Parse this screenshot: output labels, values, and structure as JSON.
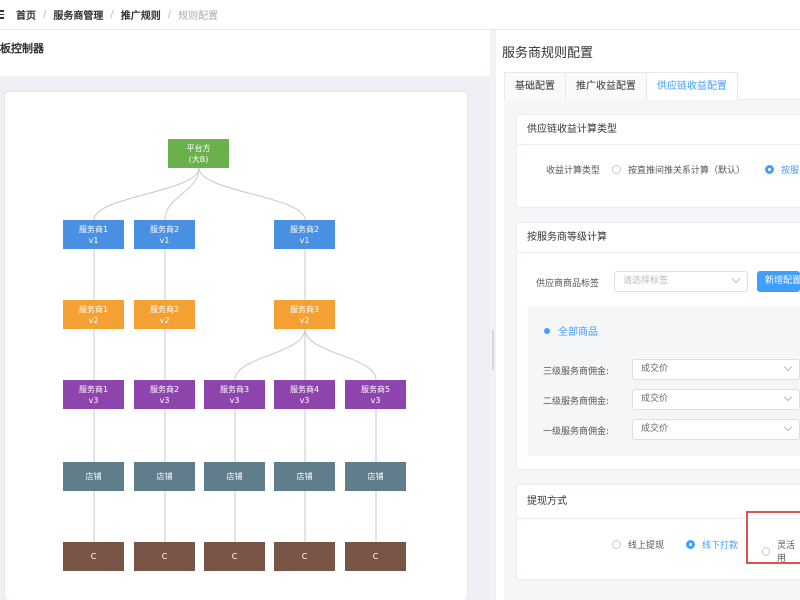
{
  "breadcrumb": [
    "首页",
    "服务商管理",
    "推广规则",
    "规则配置"
  ],
  "left": {
    "title": "板控制器"
  },
  "tree": {
    "root": {
      "line1": "平台方",
      "line2": "(大B)"
    },
    "v1": [
      {
        "name": "服务商1",
        "level": "v1"
      },
      {
        "name": "服务商2",
        "level": "v1"
      },
      {
        "name": "服务商2",
        "level": "v1"
      }
    ],
    "v2": [
      {
        "name": "服务商1",
        "level": "v2"
      },
      {
        "name": "服务商2",
        "level": "v2"
      },
      {
        "name": "服务商3",
        "level": "v2"
      }
    ],
    "v3": [
      {
        "name": "服务商1",
        "level": "v3"
      },
      {
        "name": "服务商2",
        "level": "v3"
      },
      {
        "name": "服务商3",
        "level": "v3"
      },
      {
        "name": "服务商4",
        "level": "v3"
      },
      {
        "name": "服务商5",
        "level": "v3"
      }
    ],
    "stores": [
      "店铺",
      "店铺",
      "店铺",
      "店铺",
      "店铺"
    ],
    "customers": [
      "C",
      "C",
      "C",
      "C",
      "C"
    ],
    "colors": {
      "root": "#6ab04c",
      "v1": "#4a90e2",
      "v2": "#f5a033",
      "v3": "#8e44ad",
      "store": "#607d8b",
      "customer": "#795548",
      "line": "#c8c8c8"
    }
  },
  "right": {
    "title": "服务商规则配置",
    "tabs": [
      "基础配置",
      "推广收益配置",
      "供应链收益配置"
    ],
    "active_tab": 2,
    "section1": {
      "title": "供应链收益计算类型",
      "label": "收益计算类型",
      "option1": "按直推间推关系计算（默认）",
      "option2": "按服"
    },
    "section2": {
      "title": "按服务商等级计算",
      "tag_label": "供应商商品标签",
      "tag_placeholder": "请选择标签",
      "add_button": "新增配置",
      "group_title": "全部商品",
      "rows": [
        {
          "label": "三级服务商佣金:",
          "value": "成交价"
        },
        {
          "label": "二级服务商佣金:",
          "value": "成交价"
        },
        {
          "label": "一级服务商佣金:",
          "value": "成交价"
        }
      ]
    },
    "section3": {
      "title": "提现方式",
      "options": [
        "线上提现",
        "线下打款",
        "灵活用"
      ]
    }
  }
}
